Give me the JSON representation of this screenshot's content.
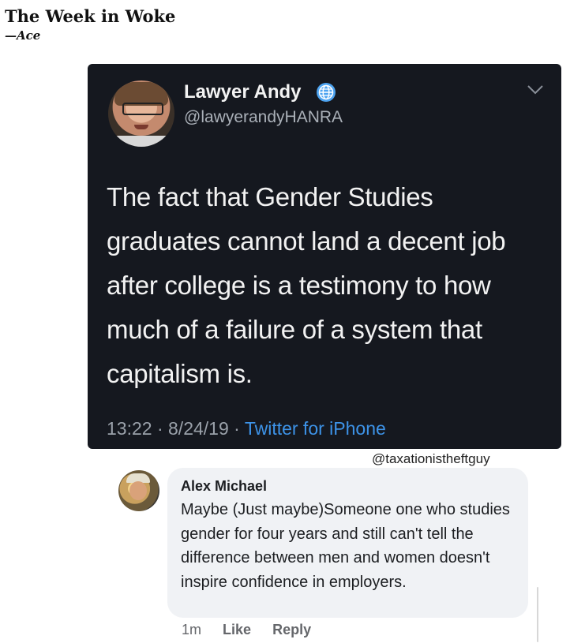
{
  "post": {
    "title": "The Week in Woke",
    "byline": "—Ace"
  },
  "tweet": {
    "display_name": "Lawyer Andy",
    "handle": "@lawyerandyHANRA",
    "text": "The fact that Gender Studies graduates cannot land a decent job after college is a testimony to how much of a failure of a system that capitalism is.",
    "time": "13:22",
    "date": "8/24/19",
    "separator": "·",
    "source": "Twitter for iPhone",
    "icons": [
      "globe-icon",
      "chevron-down-icon"
    ],
    "colors": {
      "background": "#15181f",
      "link": "#3d93e8"
    }
  },
  "watermark": "@taxationistheftguy",
  "comment": {
    "author": "Alex Michael",
    "text": "Maybe (Just maybe)Someone one who studies gender for four years and still can't tell the difference between men and women doesn't inspire confidence in employers.",
    "time_ago": "1m",
    "like_label": "Like",
    "reply_label": "Reply"
  }
}
